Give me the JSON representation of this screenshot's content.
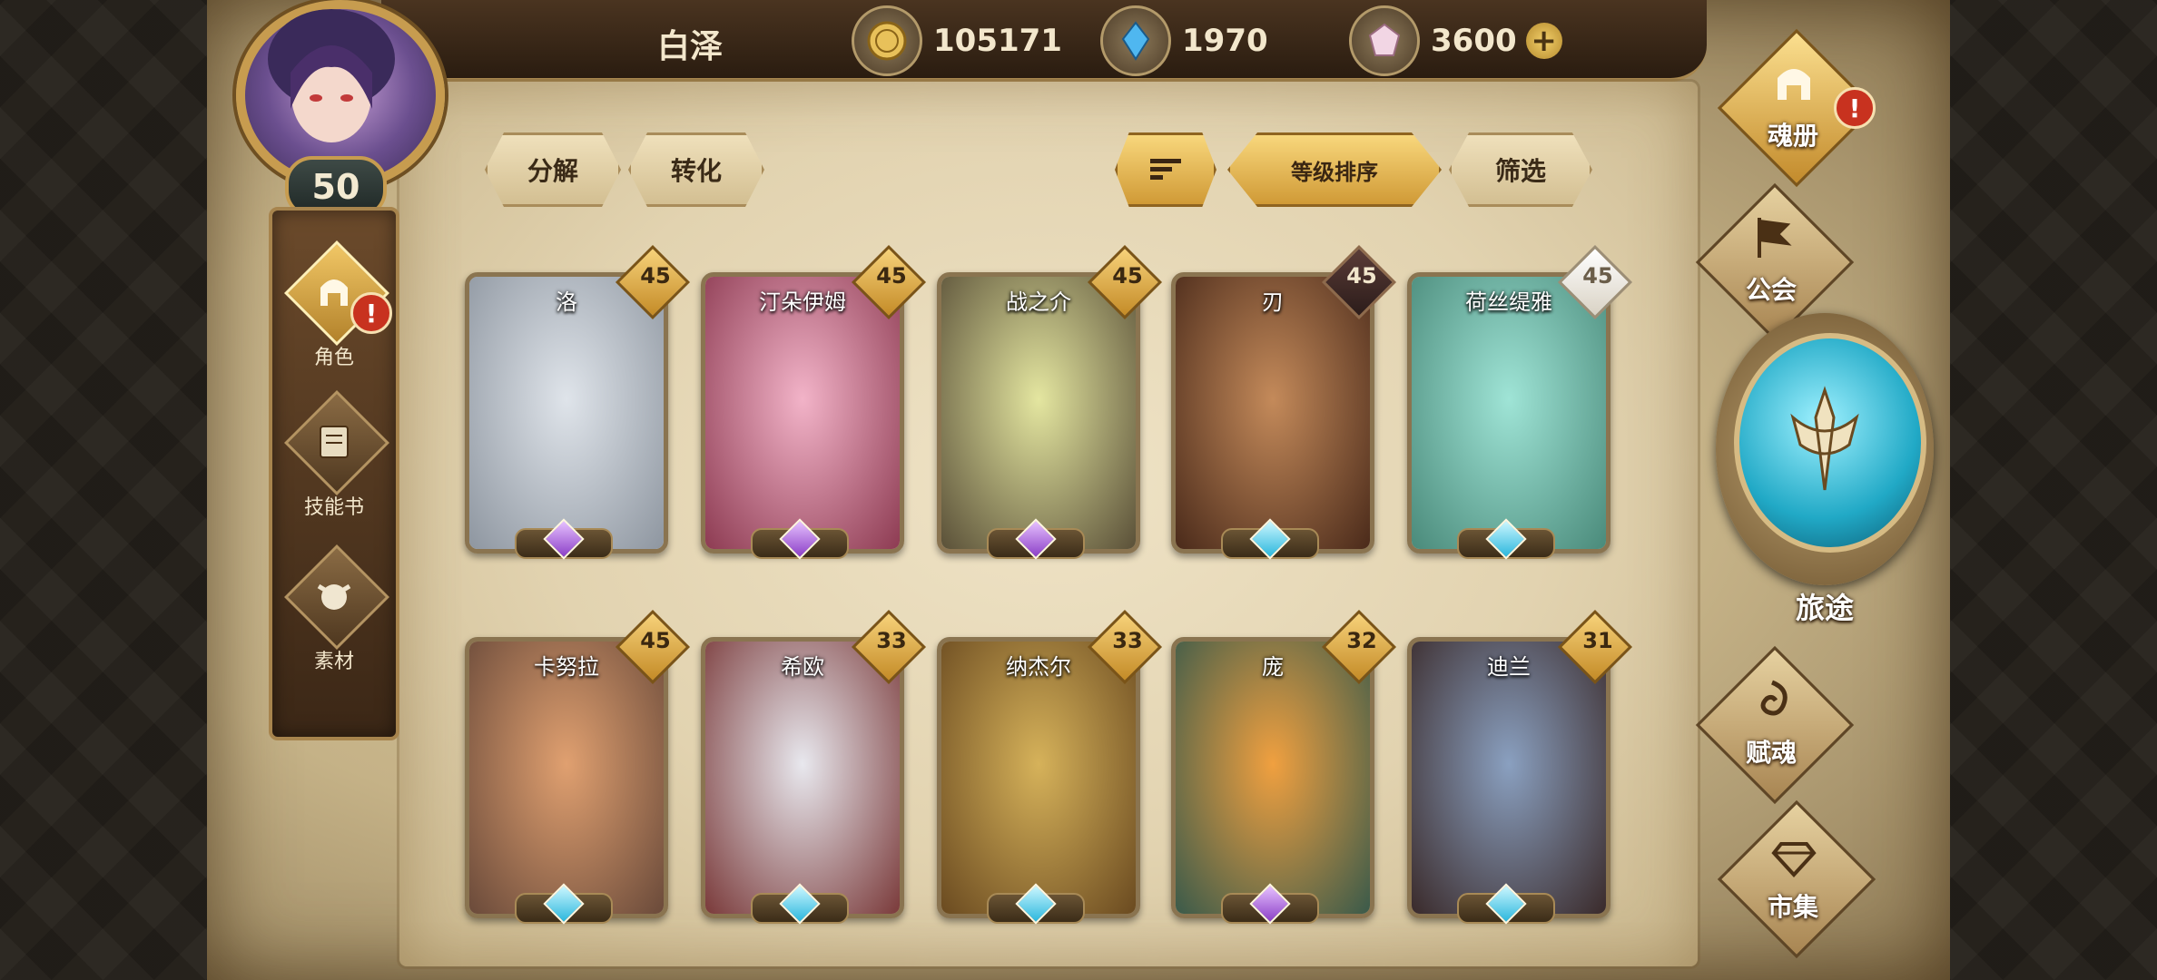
{
  "player": {
    "name": "白泽",
    "level": "50"
  },
  "currencies": [
    {
      "icon": "gold-coin-icon",
      "value": "105171"
    },
    {
      "icon": "blue-crystal-icon",
      "value": "1970"
    },
    {
      "icon": "pink-gem-icon",
      "value": "3600"
    }
  ],
  "sidebar": {
    "items": [
      {
        "label": "角色",
        "icon": "helmet-icon",
        "active": true,
        "alert": "!"
      },
      {
        "label": "技能书",
        "icon": "skill-book-icon",
        "active": false
      },
      {
        "label": "素材",
        "icon": "material-icon",
        "active": false
      }
    ]
  },
  "toolbar": {
    "decompose": "分解",
    "convert": "转化",
    "sort_level": "等级排序",
    "filter": "筛选"
  },
  "cards": [
    {
      "name": "洛",
      "level": "45",
      "badge": "gold",
      "gem": "purple",
      "colors": [
        "#dfe4ea",
        "#8e96a0"
      ]
    },
    {
      "name": "汀朵伊姆",
      "level": "45",
      "badge": "gold",
      "gem": "purple",
      "colors": [
        "#f2b3c8",
        "#8d3b52"
      ]
    },
    {
      "name": "战之介",
      "level": "45",
      "badge": "gold",
      "gem": "purple",
      "colors": [
        "#e4e6a0",
        "#5a5038"
      ]
    },
    {
      "name": "刃",
      "level": "45",
      "badge": "dark",
      "gem": "blue",
      "colors": [
        "#c48a5a",
        "#4a2a1a"
      ]
    },
    {
      "name": "荷丝缇雅",
      "level": "45",
      "badge": "white",
      "gem": "blue",
      "colors": [
        "#9fe4d6",
        "#4a8a7a"
      ]
    },
    {
      "name": "卡努拉",
      "level": "45",
      "badge": "gold",
      "gem": "blue",
      "colors": [
        "#e0a070",
        "#6a4a3a"
      ]
    },
    {
      "name": "希欧",
      "level": "33",
      "badge": "gold",
      "gem": "blue",
      "colors": [
        "#e8e8ee",
        "#7a3a3a"
      ]
    },
    {
      "name": "纳杰尔",
      "level": "33",
      "badge": "gold",
      "gem": "blue",
      "colors": [
        "#d6b25a",
        "#6a4a20"
      ]
    },
    {
      "name": "庞",
      "level": "32",
      "badge": "gold",
      "gem": "purple",
      "colors": [
        "#f0a040",
        "#3a5a4a"
      ]
    },
    {
      "name": "迪兰",
      "level": "31",
      "badge": "gold",
      "gem": "blue",
      "colors": [
        "#8aa0c0",
        "#3a2a2a"
      ]
    }
  ],
  "rightnav": {
    "soul_book": "魂册",
    "guild": "公会",
    "journey": "旅途",
    "soul_infuse": "赋魂",
    "market": "市集",
    "alert": "!"
  }
}
